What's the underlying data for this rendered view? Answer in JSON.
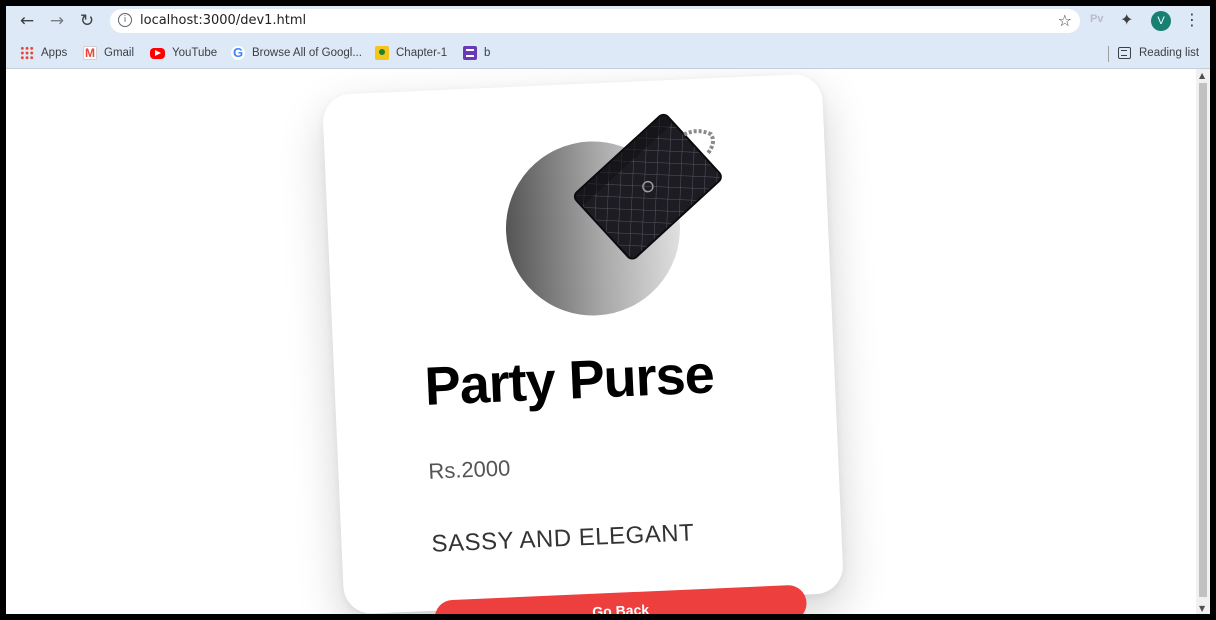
{
  "browser": {
    "url": "localhost:3000/dev1.html",
    "extension_label": "Pv",
    "avatar_letter": "V"
  },
  "bookmarks": {
    "items": [
      {
        "label": "Apps",
        "icon": "apps-grid-icon"
      },
      {
        "label": "Gmail",
        "icon": "gmail-icon"
      },
      {
        "label": "YouTube",
        "icon": "youtube-icon"
      },
      {
        "label": "Browse All of Googl...",
        "icon": "google-icon"
      },
      {
        "label": "Chapter-1",
        "icon": "classroom-icon"
      },
      {
        "label": "b",
        "icon": "forms-icon"
      }
    ],
    "reading_list": "Reading list"
  },
  "product": {
    "title": "Party Purse",
    "price": "Rs.2000",
    "tagline": "SASSY AND ELEGANT",
    "button_label": "Go Back",
    "button_color": "#ee3f3f"
  }
}
